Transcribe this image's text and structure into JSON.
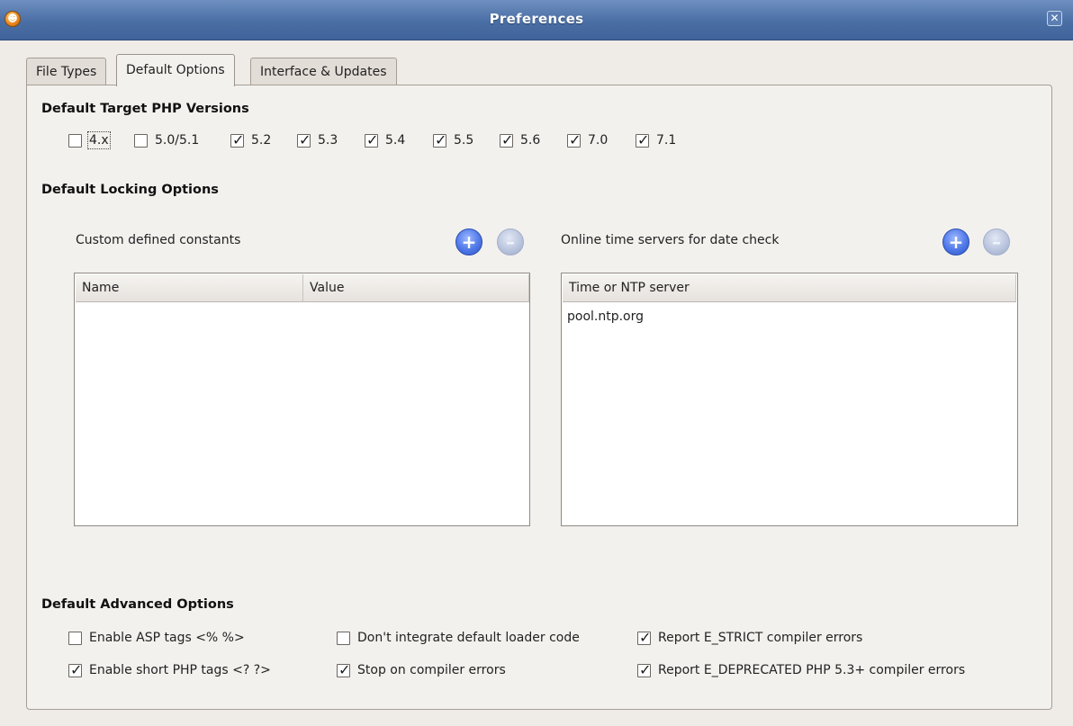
{
  "window": {
    "title": "Preferences"
  },
  "tabs": [
    {
      "label": "File Types",
      "active": false
    },
    {
      "label": "Default Options",
      "active": true
    },
    {
      "label": "Interface & Updates",
      "active": false
    }
  ],
  "php_versions": {
    "heading": "Default Target PHP Versions",
    "items": [
      {
        "label": "4.x",
        "checked": false
      },
      {
        "label": "5.0/5.1",
        "checked": false
      },
      {
        "label": "5.2",
        "checked": true
      },
      {
        "label": "5.3",
        "checked": true
      },
      {
        "label": "5.4",
        "checked": true
      },
      {
        "label": "5.5",
        "checked": true
      },
      {
        "label": "5.6",
        "checked": true
      },
      {
        "label": "7.0",
        "checked": true
      },
      {
        "label": "7.1",
        "checked": true
      }
    ]
  },
  "locking": {
    "heading": "Default Locking Options",
    "constants": {
      "label": "Custom defined constants",
      "columns": [
        "Name",
        "Value"
      ],
      "rows": []
    },
    "time_servers": {
      "label": "Online time servers for date check",
      "columns": [
        "Time or NTP server"
      ],
      "rows": [
        "pool.ntp.org"
      ]
    }
  },
  "advanced": {
    "heading": "Default Advanced Options",
    "options": [
      {
        "label": "Enable ASP tags <% %>",
        "checked": false
      },
      {
        "label": "Don't integrate default loader code",
        "checked": false
      },
      {
        "label": "Report E_STRICT compiler errors",
        "checked": true
      },
      {
        "label": "Enable short PHP tags <? ?>",
        "checked": true
      },
      {
        "label": "Stop on compiler errors",
        "checked": true
      },
      {
        "label": "Report E_DEPRECATED PHP 5.3+ compiler errors",
        "checked": true
      }
    ]
  },
  "icons": {
    "app": "app-logo-icon",
    "close": "close-icon",
    "add": "plus-icon",
    "remove": "minus-icon"
  }
}
